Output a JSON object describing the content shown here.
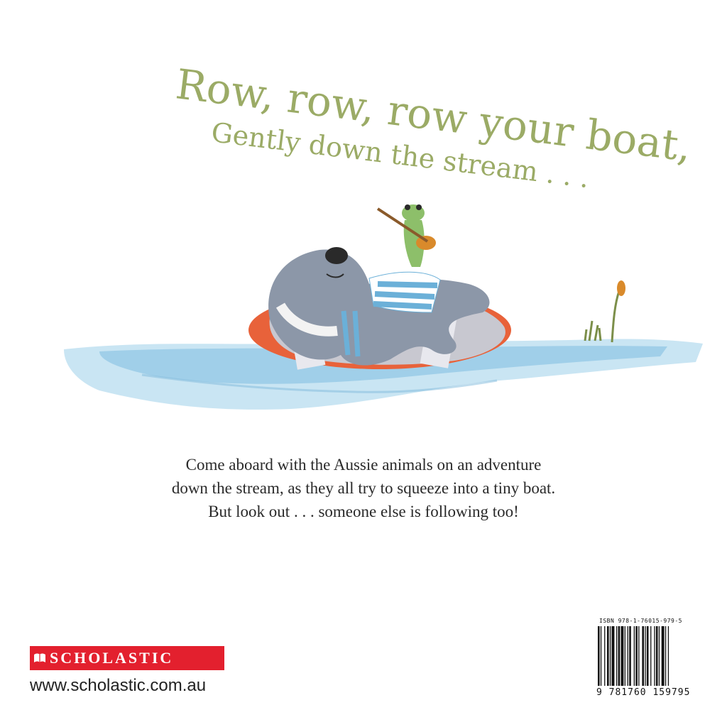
{
  "title": {
    "line1": "Row, row, row your boat,",
    "line2": "Gently down the stream . . ."
  },
  "blurb": {
    "line1": "Come aboard with the Aussie animals on an adventure",
    "line2": "down the stream, as they all try to squeeze into a tiny boat.",
    "line3": "But look out . . . someone else is following too!"
  },
  "publisher": {
    "name": "SCHOLASTIC",
    "website": "www.scholastic.com.au"
  },
  "barcode": {
    "isbn_label": "ISBN 978-1-76015-979-5",
    "digits": "9 781760 159795"
  },
  "colors": {
    "title": "#9bab66",
    "publisher_red": "#e3202e",
    "water": "#8fc6e4",
    "ring_orange": "#e8623a"
  },
  "illustration": {
    "subject": "wombat-in-swim-ring-with-frog-playing-guitar"
  }
}
